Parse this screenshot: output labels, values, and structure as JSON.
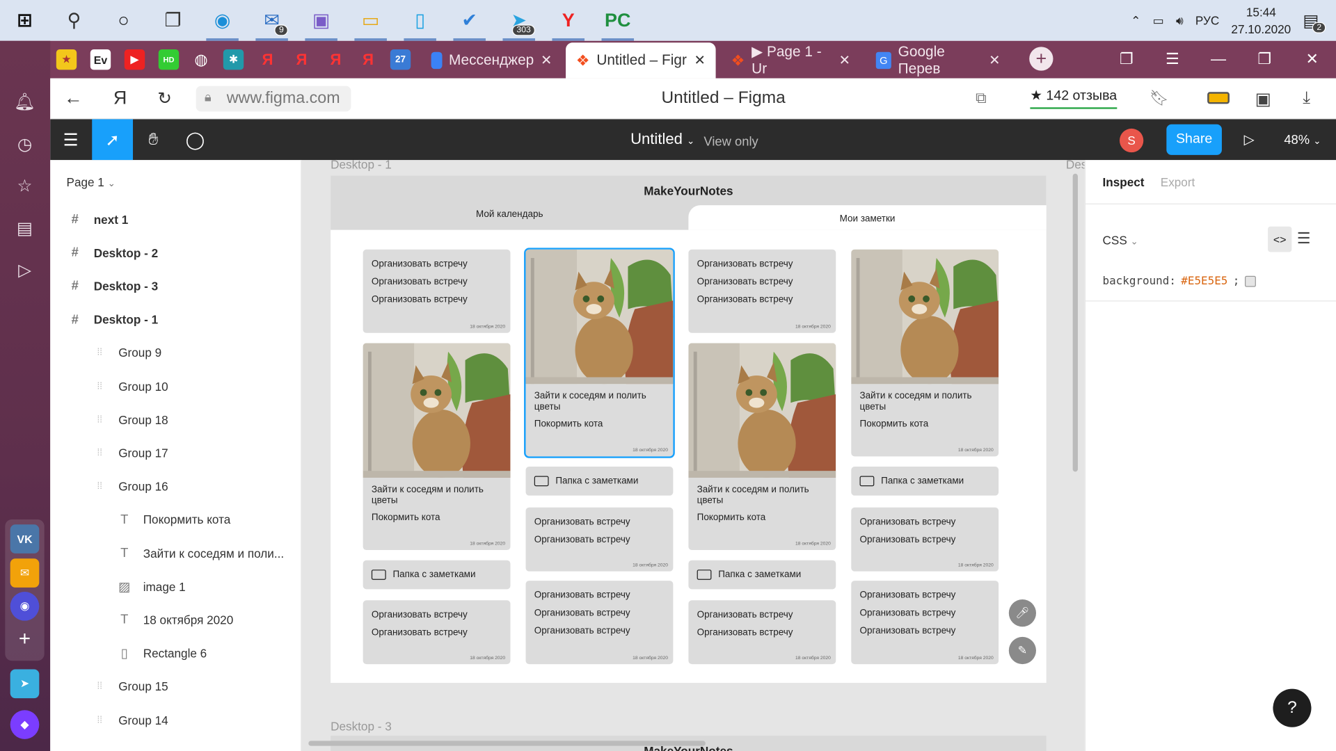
{
  "taskbar": {
    "apps": [
      {
        "icon": "windows-start-icon",
        "glyph": "⊞"
      },
      {
        "icon": "search-icon",
        "glyph": "⚲"
      },
      {
        "icon": "cortana-icon",
        "glyph": "○"
      },
      {
        "icon": "task-view-icon",
        "glyph": "❐"
      },
      {
        "icon": "edge-icon",
        "glyph": "◉"
      },
      {
        "icon": "mail-icon",
        "glyph": "✉",
        "badge": "9"
      },
      {
        "icon": "photos-icon",
        "glyph": "▣"
      },
      {
        "icon": "file-explorer-icon",
        "glyph": "▭"
      },
      {
        "icon": "phone-app-icon",
        "glyph": "▯"
      },
      {
        "icon": "todo-icon",
        "glyph": "✔"
      },
      {
        "icon": "telegram-icon",
        "glyph": "➤",
        "badge": "303"
      },
      {
        "icon": "yandex-browser-icon",
        "glyph": "Y"
      },
      {
        "icon": "pycharm-icon",
        "glyph": "PC"
      }
    ],
    "tray": {
      "language": "РУС",
      "time": "15:44",
      "date": "27.10.2020",
      "notifications": "2"
    }
  },
  "browser": {
    "tabs": [
      {
        "label": "Мессенджер",
        "active": false
      },
      {
        "label": "Untitled – Figr",
        "active": true
      },
      {
        "label": "▶ Page 1 - Ur",
        "active": false
      },
      {
        "label": "Google Перев",
        "active": false
      }
    ],
    "address": "www.figma.com",
    "page_title": "Untitled – Figma",
    "reviews": "★ 142 отзыва"
  },
  "figma": {
    "file_title": "Untitled",
    "view_mode": "View only",
    "avatar_letter": "S",
    "share_label": "Share",
    "zoom": "48%",
    "page_selector": "Page 1",
    "layers": [
      {
        "name": "next 1",
        "type": "frame",
        "depth": 0
      },
      {
        "name": "Desktop - 2",
        "type": "frame",
        "depth": 0
      },
      {
        "name": "Desktop - 3",
        "type": "frame",
        "depth": 0
      },
      {
        "name": "Desktop - 1",
        "type": "frame",
        "depth": 0
      },
      {
        "name": "Group 9",
        "type": "group",
        "depth": 1
      },
      {
        "name": "Group 10",
        "type": "group",
        "depth": 1
      },
      {
        "name": "Group 18",
        "type": "group",
        "depth": 1
      },
      {
        "name": "Group 17",
        "type": "group",
        "depth": 1
      },
      {
        "name": "Group 16",
        "type": "group",
        "depth": 1
      },
      {
        "name": "Покормить кота",
        "type": "text",
        "depth": 2
      },
      {
        "name": "Зайти к соседям и поли...",
        "type": "text",
        "depth": 2
      },
      {
        "name": "image 1",
        "type": "image",
        "depth": 2
      },
      {
        "name": "18 октября 2020",
        "type": "text",
        "depth": 2
      },
      {
        "name": "Rectangle 6",
        "type": "rect",
        "depth": 2
      },
      {
        "name": "Group 15",
        "type": "group",
        "depth": 1
      },
      {
        "name": "Group 14",
        "type": "group",
        "depth": 1
      }
    ],
    "inspect": {
      "tab_inspect": "Inspect",
      "tab_export": "Export",
      "css_label": "CSS",
      "css_prop": "background:",
      "css_value": "#E5E5E5",
      "css_swatch": "#e5e5e5"
    },
    "help": "?"
  },
  "canvas": {
    "frame1_label": "Desktop - 1",
    "frame3_label": "Desktop - 3",
    "frame_cut_label": "Des",
    "app": {
      "title": "MakeYourNotes",
      "tab_calendar": "Мой календарь",
      "tab_notes": "Мои заметки",
      "note_line": "Организовать встречу",
      "photo_text1": "Зайти к соседям и полить цветы",
      "photo_text2": "Покормить кота",
      "folder_label": "Папка с заметками",
      "date": "18 октября 2020"
    },
    "frame3_title": "MakeYourNotes"
  }
}
